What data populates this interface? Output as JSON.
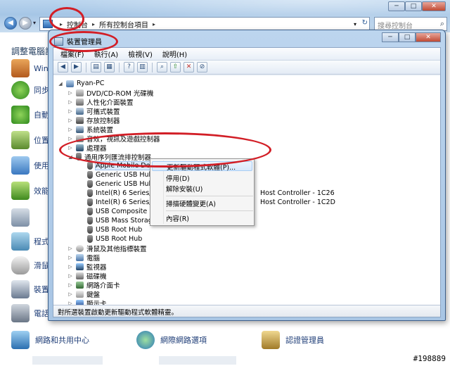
{
  "control_panel": {
    "breadcrumb": [
      "控制台",
      "所有控制台項目"
    ],
    "search_placeholder": "搜尋控制台",
    "heading": "調整電腦設",
    "side_items": [
      "Win",
      "同步",
      "自動",
      "位置",
      "使用",
      "效能",
      "程式",
      "滑鼠",
      "裝置",
      "電話"
    ],
    "bottom_items": [
      "網路和共用中心",
      "網際網路選項",
      "認證管理員"
    ]
  },
  "device_manager": {
    "title": "裝置管理員",
    "menu": [
      "檔案(F)",
      "執行(A)",
      "檢視(V)",
      "說明(H)"
    ],
    "toolbar_icons": [
      "back-icon",
      "forward-icon",
      "view-icon",
      "properties-icon",
      "help-icon",
      "view-alt-icon",
      "scan-icon",
      "update-driver-icon",
      "uninstall-icon",
      "disable-icon"
    ],
    "tree": {
      "root": "Ryan-PC",
      "categories_top": [
        "DVD/CD-ROM 光碟機",
        "人性化介面裝置",
        "可攜式裝置",
        "存放控制器",
        "系統裝置",
        "音效，視訊及遊戲控制器",
        "處理器",
        "通用序列匯流排控制器"
      ],
      "usb_children": [
        "Apple Mobile Device USB Driver",
        "Generic USB Hub",
        "Generic USB Hub",
        "Intel(R) 6 Series/C200 Series Chipset Family USB Enhanced Host Controller - 1C26",
        "Intel(R) 6 Series/C200 Series Chipset Family USB Enhanced Host Controller - 1C2D",
        "USB Composite Device",
        "USB Mass Storage Device",
        "USB Root Hub",
        "USB Root Hub"
      ],
      "usb_children_visible": [
        "Apple Mobile Devi",
        "Generic USB Hub",
        "Generic USB Hub",
        "Intel(R) 6 Series/C2",
        "Intel(R) 6 Series/C2",
        "USB Composite Devi",
        "USB Mass Storage D",
        "USB Root Hub",
        "USB Root Hub"
      ],
      "controller_suffix_1": "Host Controller - 1C26",
      "controller_suffix_2": "Host Controller - 1C2D",
      "categories_bottom": [
        "滑鼠及其他指標裝置",
        "電腦",
        "監視器",
        "磁碟機",
        "網路介面卡",
        "鍵盤",
        "顯示卡"
      ]
    },
    "context_menu": [
      "更新驅動程式軟體(P)...",
      "停用(D)",
      "解除安裝(U)",
      "掃描硬體變更(A)",
      "內容(R)"
    ],
    "status": "對所選裝置啟動更新驅動程式軟體精靈。"
  },
  "watermark": "#198889",
  "colors": {
    "annotation": "#d21e26",
    "link": "#1e3d77"
  }
}
